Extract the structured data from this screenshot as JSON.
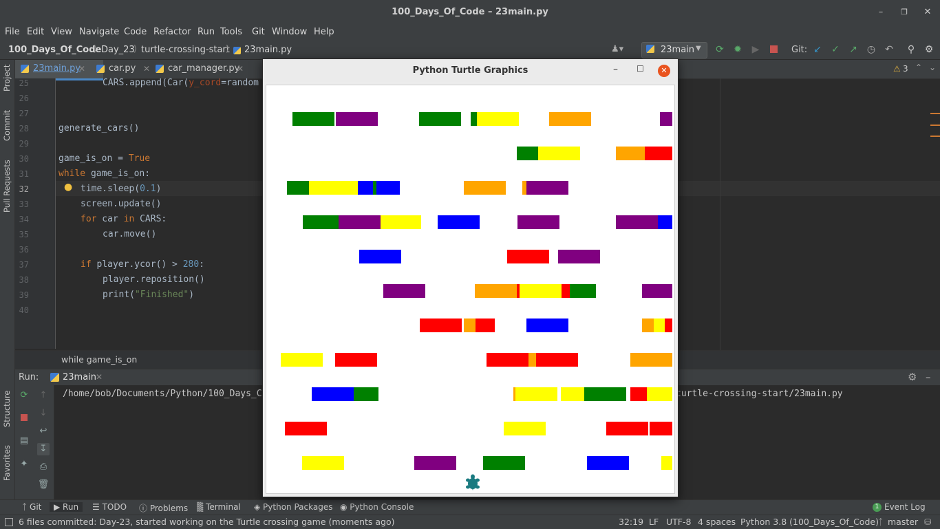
{
  "window": {
    "title": "100_Days_Of_Code – 23main.py"
  },
  "menu": [
    "File",
    "Edit",
    "View",
    "Navigate",
    "Code",
    "Refactor",
    "Run",
    "Tools",
    "Git",
    "Window",
    "Help"
  ],
  "nav": {
    "crumbs": [
      "100_Days_Of_Code",
      "Day_23",
      "turtle-crossing-start",
      "23main.py"
    ],
    "run_config": "23main",
    "git_label": "Git:"
  },
  "left_stripe": [
    "Project",
    "Commit",
    "Pull Requests",
    "Structure",
    "Favorites"
  ],
  "tabs": [
    {
      "label": "23main.py",
      "active": true
    },
    {
      "label": "car.py",
      "active": false
    },
    {
      "label": "car_manager.py",
      "active": false
    }
  ],
  "editor": {
    "warnings": "3",
    "lines": [
      "25",
      "26",
      "27",
      "28",
      "29",
      "30",
      "31",
      "32",
      "33",
      "34",
      "35",
      "36",
      "37",
      "38",
      "39",
      "40"
    ],
    "code": {
      "l25a": "CARS.append(Car(",
      "l25b": "y_cord",
      "l25c": "=random",
      "l28": "generate_cars()",
      "l30a": "game_is_on = ",
      "l30b": "True",
      "l31a": "while",
      "l31b": " game_is_on:",
      "l32a": "time.sleep(",
      "l32b": "0.1",
      "l32c": ")",
      "l33": "screen.update()",
      "l34a": "for",
      "l34b": " car ",
      "l34c": "in",
      "l34d": " CARS:",
      "l35": "car.move()",
      "l37a": "if",
      "l37b": " player.ycor() > ",
      "l37c": "280",
      "l37d": ":",
      "l38": "player.reposition()",
      "l39a": "print(",
      "l39b": "\"Finished\"",
      "l39c": ")"
    },
    "breadcrumb": "while game_is_on"
  },
  "run_panel": {
    "label": "Run:",
    "config": "23main",
    "path_left": "/home/bob/Documents/Python/100_Days_C",
    "path_right": "turtle-crossing-start/23main.py"
  },
  "bottom_tools": [
    "Git",
    "Run",
    "TODO",
    "Problems",
    "Terminal",
    "Python Packages",
    "Python Console"
  ],
  "event_log": {
    "count": "1",
    "label": "Event Log"
  },
  "status": {
    "message": "6 files committed: Day-23, started working on the Turtle crossing game (moments ago)",
    "position": "32:19",
    "line_sep": "LF",
    "encoding": "UTF-8",
    "indent": "4 spaces",
    "interpreter": "Python 3.8 (100_Days_Of_Code)",
    "branch": "master"
  },
  "turtle": {
    "title": "Python Turtle Graphics",
    "colors": {
      "green": "#008000",
      "purple": "#800080",
      "yellow": "#ffff00",
      "orange": "#ffa500",
      "red": "#ff0000",
      "blue": "#0000ff",
      "turtle": "#1a7a80"
    }
  }
}
